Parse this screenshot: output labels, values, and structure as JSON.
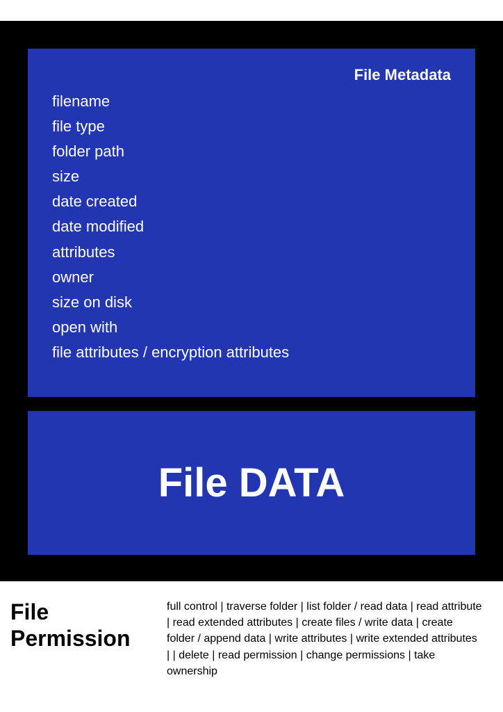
{
  "metadata": {
    "title": "File Metadata",
    "items": [
      "filename",
      "file type",
      "folder path",
      "size",
      "date created",
      "date modified",
      "attributes",
      "owner",
      "size on disk",
      "open with",
      "file attributes / encryption attributes"
    ]
  },
  "fileData": {
    "title": "File DATA"
  },
  "permission": {
    "title": "File Permission",
    "text": "full control | traverse folder |  list folder / read data | read attribute | read extended attributes | create files / write data | create folder / append data | write attributes | write extended attributes | | delete | read permission | change permissions | take ownership"
  }
}
